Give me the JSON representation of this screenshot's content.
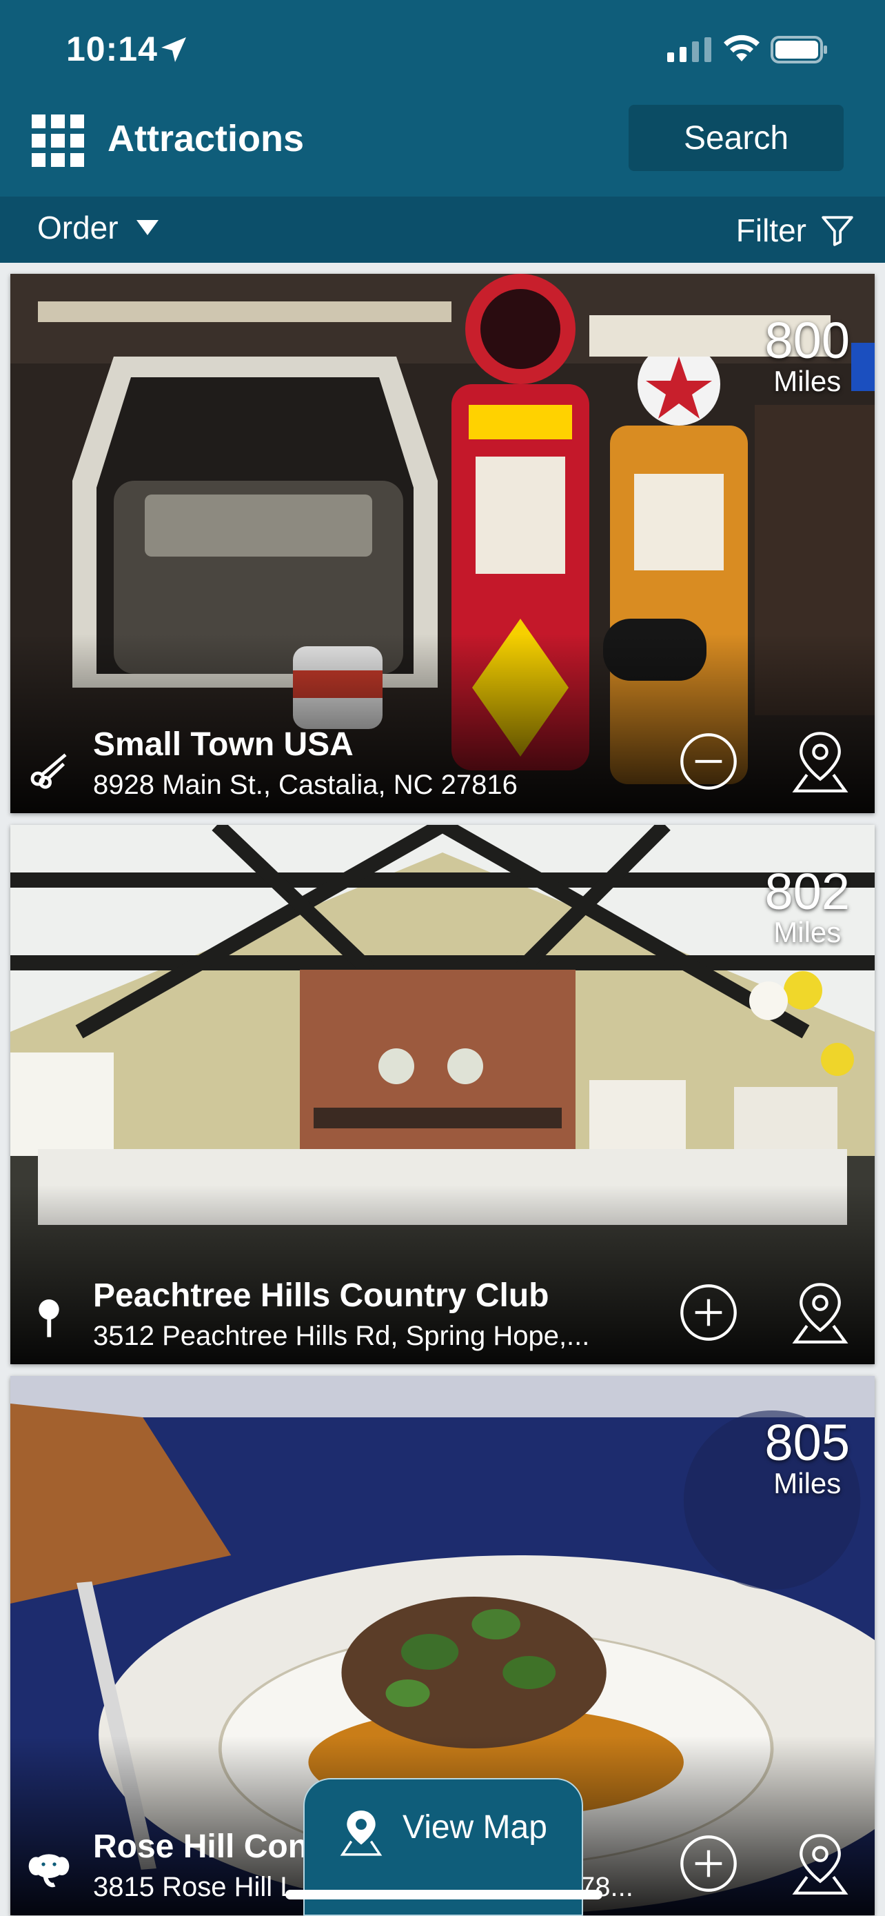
{
  "status_bar": {
    "time": "10:14"
  },
  "header": {
    "title": "Attractions",
    "search_label": "Search",
    "icons": {
      "menu": "grid-menu-icon",
      "location": "location-arrow-icon"
    }
  },
  "toolbar": {
    "order_label": "Order",
    "filter_label": "Filter"
  },
  "colors": {
    "header": "#0f5d7a",
    "subbar": "#0c4f6a",
    "search_button": "#0b4c64"
  },
  "listings": [
    {
      "distance": "800",
      "unit": "Miles",
      "name": "Small Town USA",
      "address": "8928 Main St., Castalia, NC 27816",
      "category_icon": "scissors-icon",
      "action": "remove"
    },
    {
      "distance": "802",
      "unit": "Miles",
      "name": "Peachtree Hills Country Club",
      "address": "3512 Peachtree Hills Rd, Spring Hope,...",
      "category_icon": "golf-icon",
      "action": "add"
    },
    {
      "distance": "805",
      "unit": "Miles",
      "name": "Rose Hill Con",
      "address": "3815 Rose Hill L",
      "address_tail": "78...",
      "category_icon": "elephant-icon",
      "action": "add"
    }
  ],
  "map_button": {
    "label": "View Map"
  }
}
